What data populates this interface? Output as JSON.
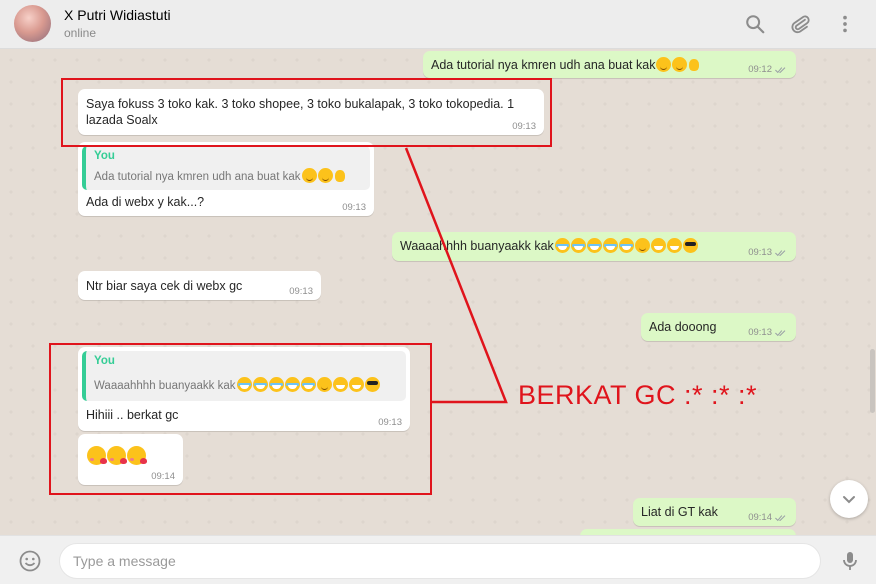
{
  "header": {
    "contact_name": "X Putri Widiastuti",
    "status": "online",
    "icons": [
      "search-icon",
      "attach-icon",
      "menu-icon"
    ]
  },
  "messages": [
    {
      "id": "m1",
      "direction": "out",
      "text": "Ada tutorial nya kmren udh ana buat kak",
      "emoji": [
        "smile",
        "smile",
        "ok"
      ],
      "time": "09:12"
    },
    {
      "id": "m2",
      "direction": "in",
      "text_line1": "Saya fokuss 3 toko kak. 3 toko shopee, 3 toko bukalapak, 3 toko tokopedia. 1",
      "text_line2": "lazada Soalx",
      "time": "09:13"
    },
    {
      "id": "m3",
      "direction": "in",
      "quote_author": "You",
      "quote_text": "Ada tutorial nya kmren udh ana buat kak",
      "quote_emoji": [
        "smile",
        "smile",
        "ok"
      ],
      "text": "Ada di webx y kak...?",
      "time": "09:13"
    },
    {
      "id": "m4",
      "direction": "out",
      "text": "Waaaahhhh buanyaakk kak",
      "emoji": [
        "laugh",
        "laugh",
        "laugh",
        "laugh",
        "laugh",
        "smile",
        "grin",
        "grin",
        "cool"
      ],
      "time": "09:13"
    },
    {
      "id": "m5",
      "direction": "in",
      "text": "Ntr biar saya cek di webx gc",
      "time": "09:13"
    },
    {
      "id": "m6",
      "direction": "out",
      "text": "Ada dooong",
      "time": "09:13"
    },
    {
      "id": "m7",
      "direction": "in",
      "quote_author": "You",
      "quote_text": "Waaaahhhh buanyaakk kak",
      "quote_emoji": [
        "laugh",
        "laugh",
        "laugh",
        "laugh",
        "laugh",
        "smile",
        "grin",
        "grin",
        "cool"
      ],
      "text": "Hihiii .. berkat gc",
      "time": "09:13"
    },
    {
      "id": "m8",
      "direction": "in",
      "emoji": [
        "kiss",
        "kiss",
        "kiss"
      ],
      "time": "09:14"
    },
    {
      "id": "m9",
      "direction": "out",
      "text": "Liat di GT kak",
      "time": "09:14"
    }
  ],
  "annotation": {
    "text": "BERKAT GC :* :* :*",
    "color": "#e0141c"
  },
  "composer": {
    "placeholder": "Type a message",
    "value": ""
  },
  "colors": {
    "incoming_bubble": "#ffffff",
    "outgoing_bubble": "#dcf8c6",
    "chat_background": "#e5ddd5",
    "quote_accent": "#35cd96",
    "annotation_red": "#e0141c"
  }
}
